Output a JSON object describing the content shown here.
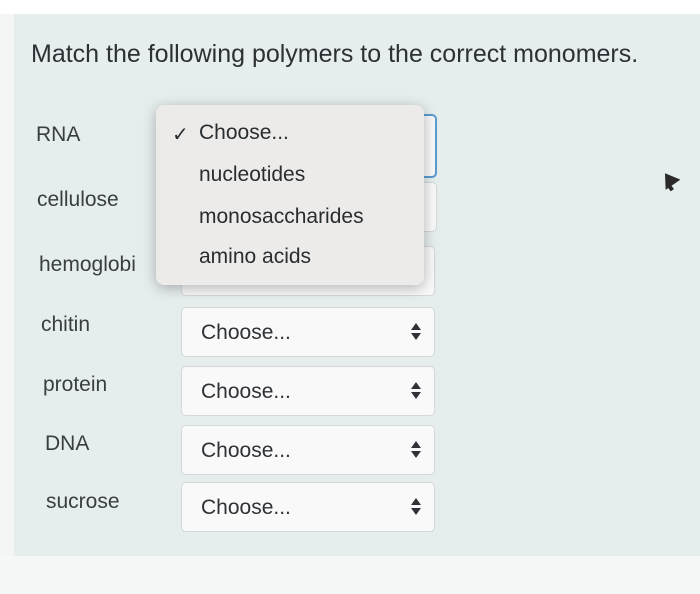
{
  "question": "Match the following polymers to the correct monomers.",
  "rows": [
    {
      "term": "RNA",
      "selected": ""
    },
    {
      "term": "cellulose",
      "selected": ""
    },
    {
      "term": "hemoglobi",
      "selected": ""
    },
    {
      "term": "chitin",
      "selected": "Choose..."
    },
    {
      "term": "protein",
      "selected": "Choose..."
    },
    {
      "term": "DNA",
      "selected": "Choose..."
    },
    {
      "term": "sucrose",
      "selected": "Choose..."
    }
  ],
  "dropdown": {
    "checkmark": "✓",
    "options": [
      "Choose...",
      "nucleotides",
      "monosaccharides",
      "amino acids"
    ]
  },
  "colors": {
    "panel": "#e6eded",
    "focus_ring": "#5b9bd0",
    "menu": "#ecebe9"
  }
}
